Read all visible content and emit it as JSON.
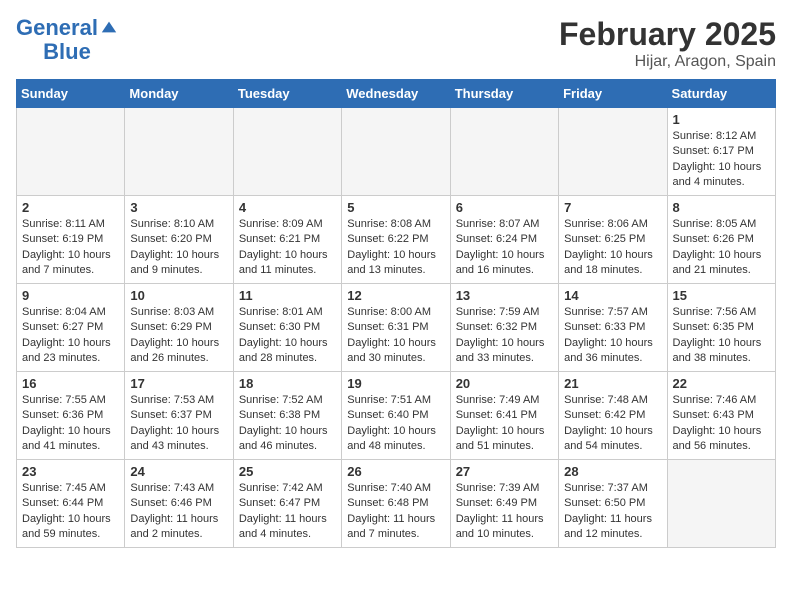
{
  "header": {
    "logo_line1": "General",
    "logo_line2": "Blue",
    "month": "February 2025",
    "location": "Hijar, Aragon, Spain"
  },
  "weekdays": [
    "Sunday",
    "Monday",
    "Tuesday",
    "Wednesday",
    "Thursday",
    "Friday",
    "Saturday"
  ],
  "weeks": [
    [
      {
        "day": "",
        "info": ""
      },
      {
        "day": "",
        "info": ""
      },
      {
        "day": "",
        "info": ""
      },
      {
        "day": "",
        "info": ""
      },
      {
        "day": "",
        "info": ""
      },
      {
        "day": "",
        "info": ""
      },
      {
        "day": "1",
        "info": "Sunrise: 8:12 AM\nSunset: 6:17 PM\nDaylight: 10 hours\nand 4 minutes."
      }
    ],
    [
      {
        "day": "2",
        "info": "Sunrise: 8:11 AM\nSunset: 6:19 PM\nDaylight: 10 hours\nand 7 minutes."
      },
      {
        "day": "3",
        "info": "Sunrise: 8:10 AM\nSunset: 6:20 PM\nDaylight: 10 hours\nand 9 minutes."
      },
      {
        "day": "4",
        "info": "Sunrise: 8:09 AM\nSunset: 6:21 PM\nDaylight: 10 hours\nand 11 minutes."
      },
      {
        "day": "5",
        "info": "Sunrise: 8:08 AM\nSunset: 6:22 PM\nDaylight: 10 hours\nand 13 minutes."
      },
      {
        "day": "6",
        "info": "Sunrise: 8:07 AM\nSunset: 6:24 PM\nDaylight: 10 hours\nand 16 minutes."
      },
      {
        "day": "7",
        "info": "Sunrise: 8:06 AM\nSunset: 6:25 PM\nDaylight: 10 hours\nand 18 minutes."
      },
      {
        "day": "8",
        "info": "Sunrise: 8:05 AM\nSunset: 6:26 PM\nDaylight: 10 hours\nand 21 minutes."
      }
    ],
    [
      {
        "day": "9",
        "info": "Sunrise: 8:04 AM\nSunset: 6:27 PM\nDaylight: 10 hours\nand 23 minutes."
      },
      {
        "day": "10",
        "info": "Sunrise: 8:03 AM\nSunset: 6:29 PM\nDaylight: 10 hours\nand 26 minutes."
      },
      {
        "day": "11",
        "info": "Sunrise: 8:01 AM\nSunset: 6:30 PM\nDaylight: 10 hours\nand 28 minutes."
      },
      {
        "day": "12",
        "info": "Sunrise: 8:00 AM\nSunset: 6:31 PM\nDaylight: 10 hours\nand 30 minutes."
      },
      {
        "day": "13",
        "info": "Sunrise: 7:59 AM\nSunset: 6:32 PM\nDaylight: 10 hours\nand 33 minutes."
      },
      {
        "day": "14",
        "info": "Sunrise: 7:57 AM\nSunset: 6:33 PM\nDaylight: 10 hours\nand 36 minutes."
      },
      {
        "day": "15",
        "info": "Sunrise: 7:56 AM\nSunset: 6:35 PM\nDaylight: 10 hours\nand 38 minutes."
      }
    ],
    [
      {
        "day": "16",
        "info": "Sunrise: 7:55 AM\nSunset: 6:36 PM\nDaylight: 10 hours\nand 41 minutes."
      },
      {
        "day": "17",
        "info": "Sunrise: 7:53 AM\nSunset: 6:37 PM\nDaylight: 10 hours\nand 43 minutes."
      },
      {
        "day": "18",
        "info": "Sunrise: 7:52 AM\nSunset: 6:38 PM\nDaylight: 10 hours\nand 46 minutes."
      },
      {
        "day": "19",
        "info": "Sunrise: 7:51 AM\nSunset: 6:40 PM\nDaylight: 10 hours\nand 48 minutes."
      },
      {
        "day": "20",
        "info": "Sunrise: 7:49 AM\nSunset: 6:41 PM\nDaylight: 10 hours\nand 51 minutes."
      },
      {
        "day": "21",
        "info": "Sunrise: 7:48 AM\nSunset: 6:42 PM\nDaylight: 10 hours\nand 54 minutes."
      },
      {
        "day": "22",
        "info": "Sunrise: 7:46 AM\nSunset: 6:43 PM\nDaylight: 10 hours\nand 56 minutes."
      }
    ],
    [
      {
        "day": "23",
        "info": "Sunrise: 7:45 AM\nSunset: 6:44 PM\nDaylight: 10 hours\nand 59 minutes."
      },
      {
        "day": "24",
        "info": "Sunrise: 7:43 AM\nSunset: 6:46 PM\nDaylight: 11 hours\nand 2 minutes."
      },
      {
        "day": "25",
        "info": "Sunrise: 7:42 AM\nSunset: 6:47 PM\nDaylight: 11 hours\nand 4 minutes."
      },
      {
        "day": "26",
        "info": "Sunrise: 7:40 AM\nSunset: 6:48 PM\nDaylight: 11 hours\nand 7 minutes."
      },
      {
        "day": "27",
        "info": "Sunrise: 7:39 AM\nSunset: 6:49 PM\nDaylight: 11 hours\nand 10 minutes."
      },
      {
        "day": "28",
        "info": "Sunrise: 7:37 AM\nSunset: 6:50 PM\nDaylight: 11 hours\nand 12 minutes."
      },
      {
        "day": "",
        "info": ""
      }
    ]
  ]
}
